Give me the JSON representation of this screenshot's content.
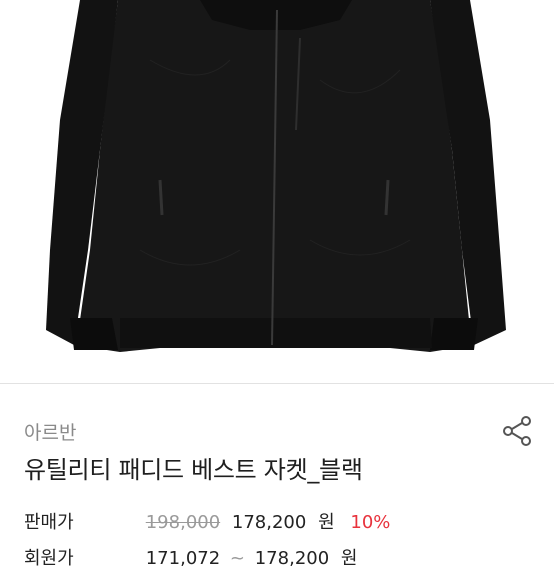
{
  "product": {
    "image_alt": "black padded jacket",
    "brand": "아르반",
    "title": "유틸리티 패디드 베스트 자켓_블랙"
  },
  "pricing": {
    "sale": {
      "label": "판매가",
      "original_price": "198,000",
      "price": "178,200",
      "currency": "원",
      "discount": "10%"
    },
    "member": {
      "label": "회원가",
      "price_low": "171,072",
      "separator": "~",
      "price_high": "178,200",
      "currency": "원"
    }
  },
  "icons": {
    "share": "share-icon"
  },
  "colors": {
    "discount": "#e8323c",
    "jacket": "#161616"
  }
}
